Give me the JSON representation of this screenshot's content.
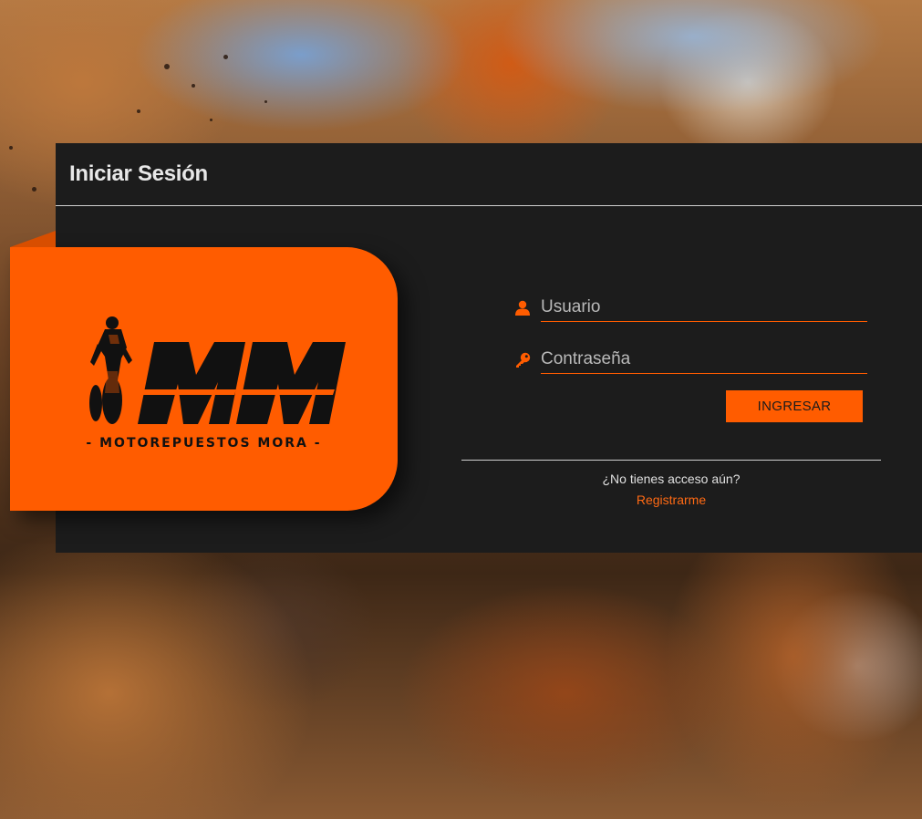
{
  "login": {
    "title": "Iniciar Sesión",
    "username_placeholder": "Usuario",
    "password_placeholder": "Contraseña",
    "submit_label": "INGRESAR",
    "no_access_text": "¿No tienes acceso aún?",
    "register_link": "Registrarme"
  },
  "brand": {
    "monogram": "MM",
    "tagline": "- MOTOREPUESTOS MORA -"
  },
  "icons": {
    "username": "user-icon",
    "password": "key-icon"
  },
  "colors": {
    "accent": "#ff5c00",
    "panel": "#1c1c1c",
    "text": "#e8e8e8"
  }
}
